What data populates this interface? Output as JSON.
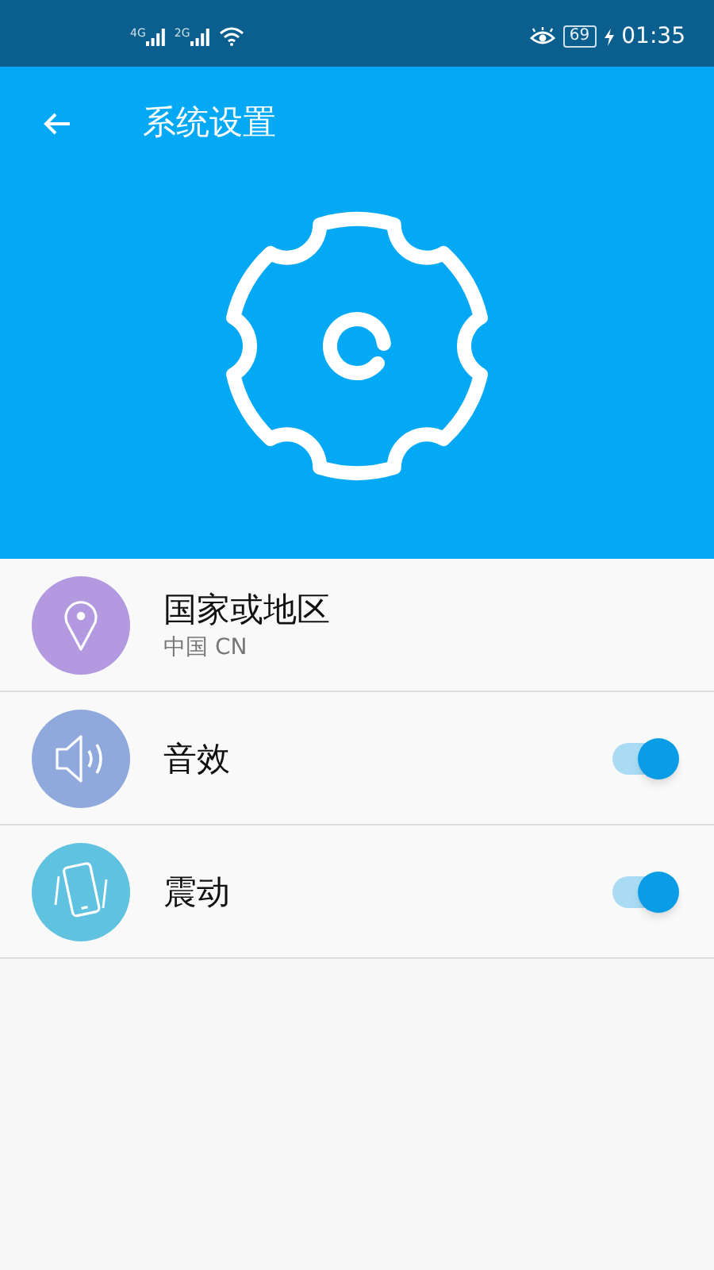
{
  "status_bar": {
    "network_1": "4G",
    "network_2": "2G",
    "battery": "69",
    "time": "01:35"
  },
  "header": {
    "title": "系统设置"
  },
  "items": [
    {
      "kind": "link",
      "title": "国家或地区",
      "subtitle": "中国 CN",
      "color": "#b39ae0"
    },
    {
      "kind": "toggle",
      "title": "音效",
      "on": true,
      "color": "#8fa9dd"
    },
    {
      "kind": "toggle",
      "title": "震动",
      "on": true,
      "color": "#5ec2e0"
    }
  ]
}
